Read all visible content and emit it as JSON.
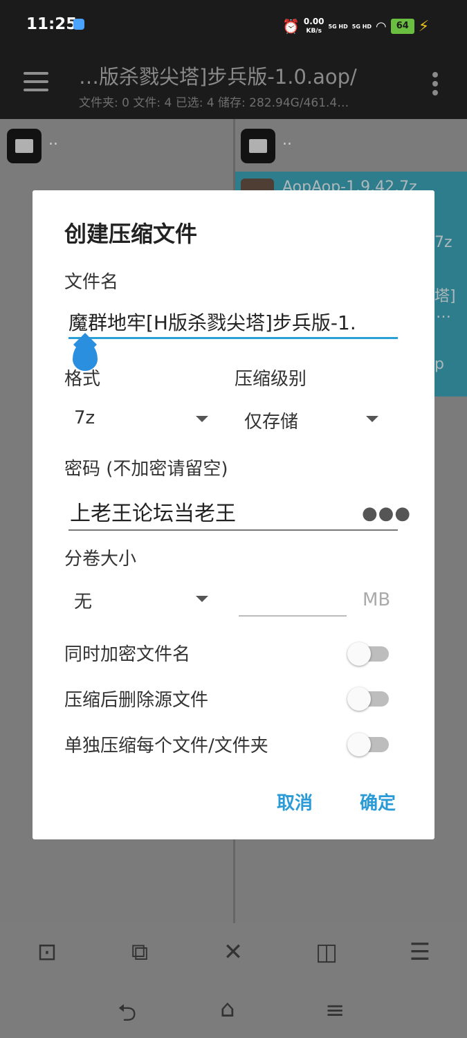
{
  "status_bar": {
    "time": "11:25",
    "speed_value": "0.00",
    "speed_unit": "KB/s",
    "signal1": "5G HD",
    "signal2": "5G HD",
    "battery": "64"
  },
  "app_bar": {
    "path_title": "…版杀戮尖塔]步兵版-1.0.aop/",
    "path_subtitle": "文件夹: 0  文件: 4  已选: 4  储存: 282.94G/461.4…"
  },
  "left_pane": {
    "parent_label": ".."
  },
  "right_pane": {
    "parent_label": "..",
    "item_fragments": [
      "AopAop-1.9.42.7z",
      "7z",
      "塔]",
      "…",
      "p"
    ]
  },
  "dialog": {
    "title": "创建压缩文件",
    "filename_label": "文件名",
    "filename_value": "魔群地牢[H版杀戮尖塔]步兵版-1.",
    "format_label": "格式",
    "format_value": "7z",
    "level_label": "压缩级别",
    "level_value": "仅存储",
    "password_label": "密码 (不加密请留空)",
    "password_value": "上老王论坛当老王",
    "volume_label": "分卷大小",
    "volume_value": "无",
    "volume_size_value": "",
    "volume_unit": "MB",
    "toggles": [
      {
        "label": "同时加密文件名",
        "on": false
      },
      {
        "label": "压缩后删除源文件",
        "on": false
      },
      {
        "label": "单独压缩每个文件/文件夹",
        "on": false
      }
    ],
    "cancel_label": "取消",
    "ok_label": "确定",
    "accent_color": "#2a9bd6"
  },
  "toolbar": {
    "icons": [
      "select-all-icon",
      "select-range-icon",
      "close-icon",
      "invert-select-icon",
      "list-select-icon"
    ]
  },
  "nav_bar": {
    "icons": [
      "back-icon",
      "home-icon",
      "recents-icon"
    ]
  }
}
